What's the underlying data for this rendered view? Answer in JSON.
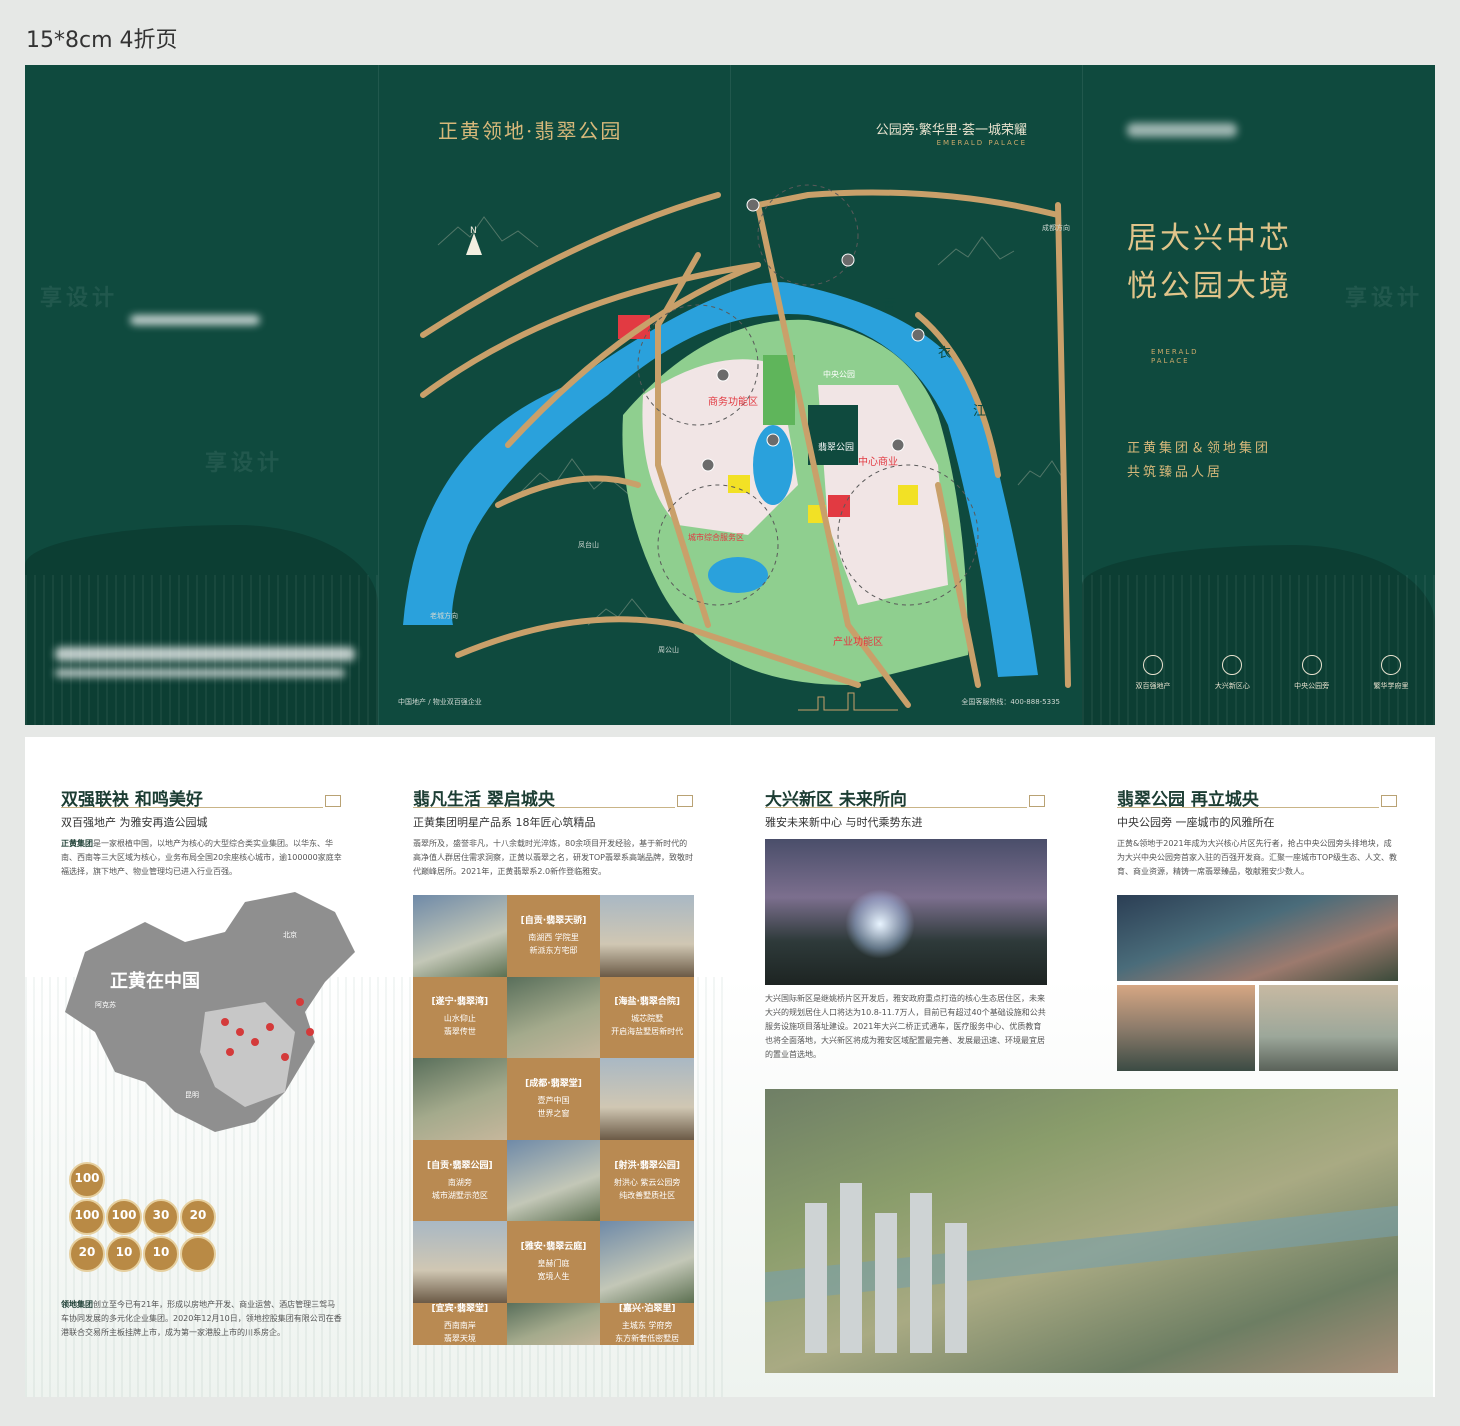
{
  "spec_label": "15*8cm 4折页",
  "outer": {
    "map_panel": {
      "title": "正黄领地·翡翠公园",
      "slogan": "公园旁·繁华里·荟一城荣耀",
      "brand_en": "EMERALD PALACE",
      "map_labels": {
        "river_chars": [
          "青",
          "衣",
          "江"
        ],
        "zones": [
          "中央公园",
          "中心商业",
          "商务功能区",
          "产业功能区",
          "城市综合服务区",
          "翡翠公园"
        ],
        "mountains": [
          "凤台山",
          "周公山"
        ],
        "directions": [
          "N",
          "成都方向",
          "老城方向"
        ]
      },
      "footer_left": "中国地产 / 物业双百强企业",
      "footer_right": "全国客服热线：400-888-5335"
    },
    "cover_panel": {
      "headline_line1": "居大兴中芯",
      "headline_line2": "悦公园大境",
      "logo_line1": "EMERALD",
      "logo_line2": "PALACE",
      "joint_line1": "正黄集团＆领地集团",
      "joint_line2": "共筑臻品人居",
      "icons": [
        {
          "name": "building-icon",
          "label": "双百强地产"
        },
        {
          "name": "compass-icon",
          "label": "大兴新区心"
        },
        {
          "name": "park-icon",
          "label": "中央公园旁"
        },
        {
          "name": "water-icon",
          "label": "繁华学府里"
        }
      ]
    },
    "watermark": "享设计"
  },
  "inner": {
    "panel1": {
      "title": "双强联袂 和鸣美好",
      "subtitle": "双百强地产 为雅安再造公园城",
      "body_lead": "正黄集团",
      "body": "是一家根植中国，以地产为核心的大型综合类实业集团。以华东、华南、西南等三大区域为核心，业务布局全国20余座核心城市，逾100000家庭幸福选择，旗下地产、物业管理均已进入行业百强。",
      "map_text": "正黄在中国",
      "map_cities": [
        "北京",
        "阿克苏",
        "昆明"
      ],
      "badges": [
        "100",
        "100",
        "100",
        "30",
        "20",
        "20",
        "10",
        "10",
        ""
      ],
      "body2_lead": "领地集团",
      "body2": "创立至今已有21年，形成以房地产开发、商业运营、酒店管理三驾马车协同发展的多元化企业集团。2020年12月10日，领地控股集团有限公司在香港联合交易所主板挂牌上市，成为第一家港股上市的川系房企。"
    },
    "panel2": {
      "title": "翡凡生活 翠启城央",
      "subtitle": "正黄集团明星产品系 18年匠心筑精品",
      "body": "翡翠所及，盛誉非凡，十八余载时光淬炼，80余项目开发经验，基于新时代的高净值人群居住需求洞察，正黄以翡翠之名，研发TOP翡翠系高端品牌，致敬时代巅峰居所。2021年，正黄翡翠系2.0新作登临雅安。",
      "projects": [
        {
          "name": "[自贡·翡翠天骄]",
          "desc1": "南湖西 学院里",
          "desc2": "新派东方宅邸"
        },
        {
          "name": "[遂宁·翡翠湾]",
          "desc1": "山水仰止",
          "desc2": "翡翠传世"
        },
        {
          "name": "[海盐·翡翠合院]",
          "desc1": "城芯院墅",
          "desc2": "开启海盐墅居新时代"
        },
        {
          "name": "[成都·翡翠堂]",
          "desc1": "壹芦中国",
          "desc2": "世界之窗"
        },
        {
          "name": "[自贡·翡翠公园]",
          "desc1": "南湖旁",
          "desc2": "城市湖墅示范区"
        },
        {
          "name": "[射洪·翡翠公园]",
          "desc1": "射洪心 紫云公园旁",
          "desc2": "纯改善墅质社区"
        },
        {
          "name": "[雅安·翡翠云庭]",
          "desc1": "皇赫门庭",
          "desc2": "宽境人生"
        },
        {
          "name": "[宜宾·翡翠堂]",
          "desc1": "西南南岸",
          "desc2": "翡翠天境"
        },
        {
          "name": "[嘉兴·泊翠里]",
          "desc1": "主城东 学府旁",
          "desc2": "东方新奢低密墅居"
        }
      ]
    },
    "panel3": {
      "title": "大兴新区 未来所向",
      "subtitle": "雅安未来新中心 与时代乘势东进",
      "body": "大兴国际新区是继姚桥片区开发后，雅安政府重点打造的核心生态居住区，未来大兴的规划居住人口将达为10.8-11.7万人，目前已有超过40个基础设施和公共服务设施项目落址建设。2021年大兴二桥正式通车，医疗服务中心、优质教育也将全面落地，大兴新区将成为雅安区域配置最完善、发展最迅速、环境最宜居的置业首选地。"
    },
    "panel4": {
      "title": "翡翠公园 再立城央",
      "subtitle": "中央公园旁 一座城市的风雅所在",
      "body": "正黄&领地于2021年成为大兴核心片区先行者，抢占中央公园旁头排地块，成为大兴中央公园旁首家入驻的百强开发商。汇聚一座城市TOP级生态、人文、教育、商业资源，精铸一席翡翠臻品，敬献雅安少数人。"
    }
  }
}
